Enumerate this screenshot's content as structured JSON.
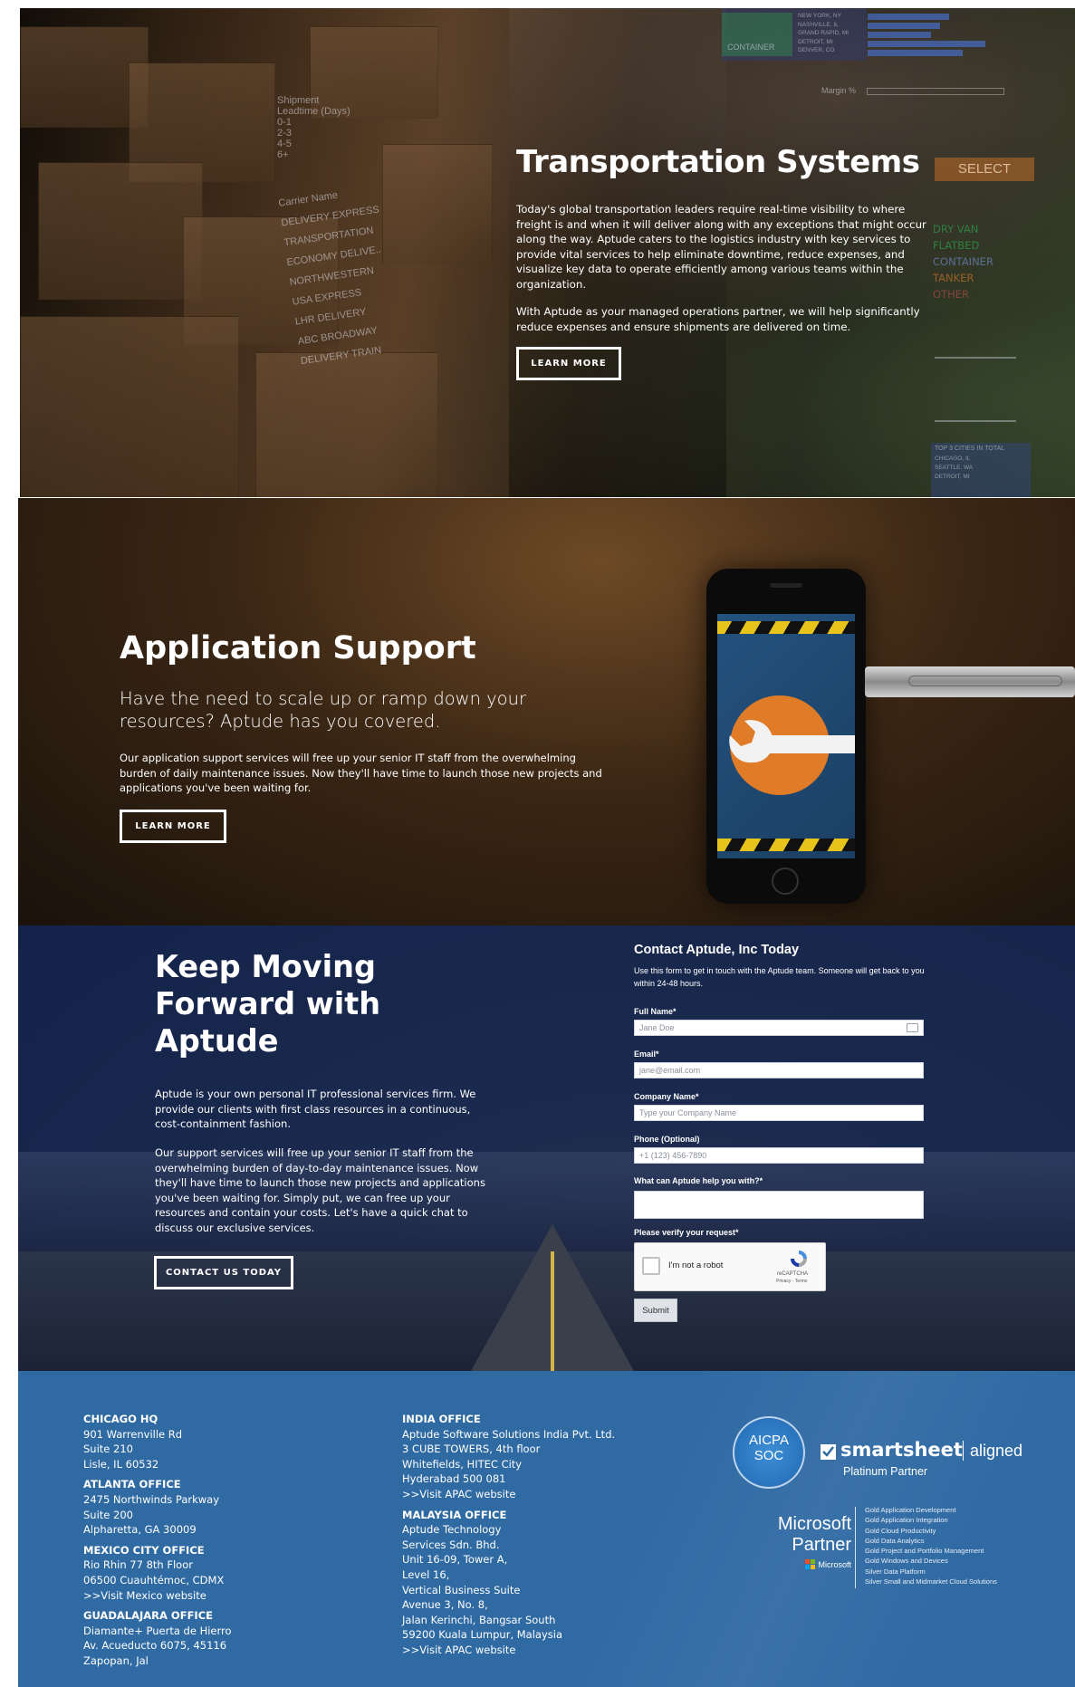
{
  "transport": {
    "title": "Transportation Systems",
    "para1": "Today's global transportation leaders require real-time visibility to where freight is and when it will deliver along with any exceptions that might occur along the way. Aptude caters to the logistics industry with key services to provide vital services to help eliminate downtime, reduce expenses, and visualize key data to operate efficiently among various teams within the organization.",
    "para2": "With Aptude as your managed operations partner, we will help significantly reduce expenses and ensure shipments are delivered on time.",
    "button": "LEARN MORE",
    "background_text": {
      "shipment": "Shipment",
      "leadtime": "Leadtime (Days)",
      "ranges": [
        "0-1",
        "2-3",
        "4-5",
        "6+"
      ],
      "carrier_name": "Carrier Name",
      "carriers": [
        "DELIVERY EXPRESS",
        "TRANSPORTATION",
        "ECONOMY DELIVE..",
        "NORTHWESTERN",
        "USA EXPRESS",
        "LHR DELIVERY",
        "ABC BROADWAY",
        "DELIVERY TRAIN"
      ],
      "cities_top": [
        "NEW YORK, NY",
        "NASHVILLE, IL",
        "GRAND RAPID, MI",
        "DETROIT, MI",
        "DENVER, CO"
      ],
      "container": "CONTAINER",
      "margin": "Margin %",
      "select": "SELECT",
      "filter_items": [
        "DRY VAN",
        "FLATBED",
        "CONTAINER",
        "TANKER",
        "OTHER"
      ],
      "top_cities": "TOP 3 CITIES IN TOTAL",
      "cities_bottom": [
        "CHICAGO, IL",
        "SEATTLE, WA",
        "DETROIT, MI"
      ]
    }
  },
  "app_support": {
    "title": "Application Support",
    "subtitle": "Have the need to scale up or ramp down your resources? Aptude has you covered.",
    "body": "Our application support services will free up your senior IT staff from the overwhelming burden of daily maintenance issues. Now they'll have time to launch those new projects and applications you've been waiting for.",
    "button": "LEARN MORE"
  },
  "keep_moving": {
    "title_line1": "Keep Moving",
    "title_line2": "Forward with",
    "title_line3": "Aptude",
    "para1": "Aptude is your own personal IT professional services firm. We provide our clients with first class resources in a continuous, cost-containment fashion.",
    "para2": "Our support services will free up your senior IT staff from the overwhelming burden of day-to-day maintenance issues. Now they'll have time to launch those new projects and applications you've been waiting for. Simply put, we can free up your resources and contain your costs. Let's have a quick chat to discuss our exclusive services.",
    "button": "CONTACT US TODAY"
  },
  "contact_form": {
    "title": "Contact Aptude, Inc Today",
    "intro": "Use this form to get in touch with the Aptude team. Someone will get back to you within 24-48 hours.",
    "full_name_label": "Full Name*",
    "full_name_placeholder": "Jane Doe",
    "email_label": "Email*",
    "email_placeholder": "jane@email.com",
    "company_label": "Company Name*",
    "company_placeholder": "Type your Company Name",
    "phone_label": "Phone (Optional)",
    "phone_placeholder": "+1 (123) 456-7890",
    "help_label": "What can Aptude help you with?*",
    "verify_label": "Please verify your request*",
    "captcha_text": "I'm not a robot",
    "captcha_brand": "reCAPTCHA",
    "captcha_links": "Privacy - Terms",
    "submit": "Submit"
  },
  "footer": {
    "offices_left": [
      {
        "name": "CHICAGO HQ",
        "lines": [
          "901 Warrenville Rd",
          "Suite 210",
          "Lisle, IL 60532"
        ]
      },
      {
        "name": "ATLANTA OFFICE",
        "lines": [
          "2475 Northwinds Parkway",
          "Suite 200",
          "Alpharetta, GA 30009"
        ]
      },
      {
        "name": "MEXICO CITY OFFICE",
        "lines": [
          "Rio Rhin 77 8th Floor",
          "06500 Cuauhtémoc, CDMX"
        ],
        "link": ">>Visit Mexico website"
      },
      {
        "name": "GUADALAJARA OFFICE",
        "lines": [
          "Diamante+ Puerta de Hierro",
          "Av. Acueducto 6075, 45116",
          "Zapopan, Jal"
        ]
      }
    ],
    "offices_right": [
      {
        "name": "INDIA OFFICE",
        "lines": [
          "Aptude Software Solutions India Pvt. Ltd.",
          "3 CUBE TOWERS, 4th floor",
          "Whitefields, HITEC City",
          "Hyderabad 500 081"
        ],
        "link": ">>Visit APAC website"
      },
      {
        "name": "MALAYSIA OFFICE",
        "lines": [
          "Aptude Technology",
          "Services Sdn. Bhd.",
          "Unit 16-09, Tower A,",
          "Level 16,",
          "Vertical Business Suite",
          "Avenue 3, No. 8,",
          "Jalan Kerinchi, Bangsar South",
          "59200 Kuala Lumpur, Malaysia"
        ],
        "link": ">>Visit APAC website"
      }
    ],
    "aicpa_line1": "AICPA",
    "aicpa_line2": "SOC",
    "smartsheet_brand": "smartsheet",
    "smartsheet_aligned": "aligned",
    "smartsheet_partner": "Platinum Partner",
    "ms_partner_line1": "Microsoft",
    "ms_partner_line2": "Partner",
    "ms_small": "Microsoft",
    "ms_competencies": [
      "Gold Application Development",
      "Gold Application Integration",
      "Gold Cloud Productivity",
      "Gold Data Analytics",
      "Gold Project and Portfolio Management",
      "Gold Windows and Devices",
      "Silver Data Platform",
      "Silver Small and Midmarket Cloud Solutions"
    ]
  },
  "colors": {
    "footer_bg": "#2f6aa3",
    "form_bg": "#1e3563",
    "accent_orange": "#e07b28",
    "filter_green": "#2ea84f"
  },
  "icons": [
    "wrench-icon",
    "checkbox-icon",
    "recaptcha-icon",
    "contact-card-icon",
    "windows-logo-icon",
    "smartsheet-logo-icon",
    "aicpa-seal-icon"
  ]
}
